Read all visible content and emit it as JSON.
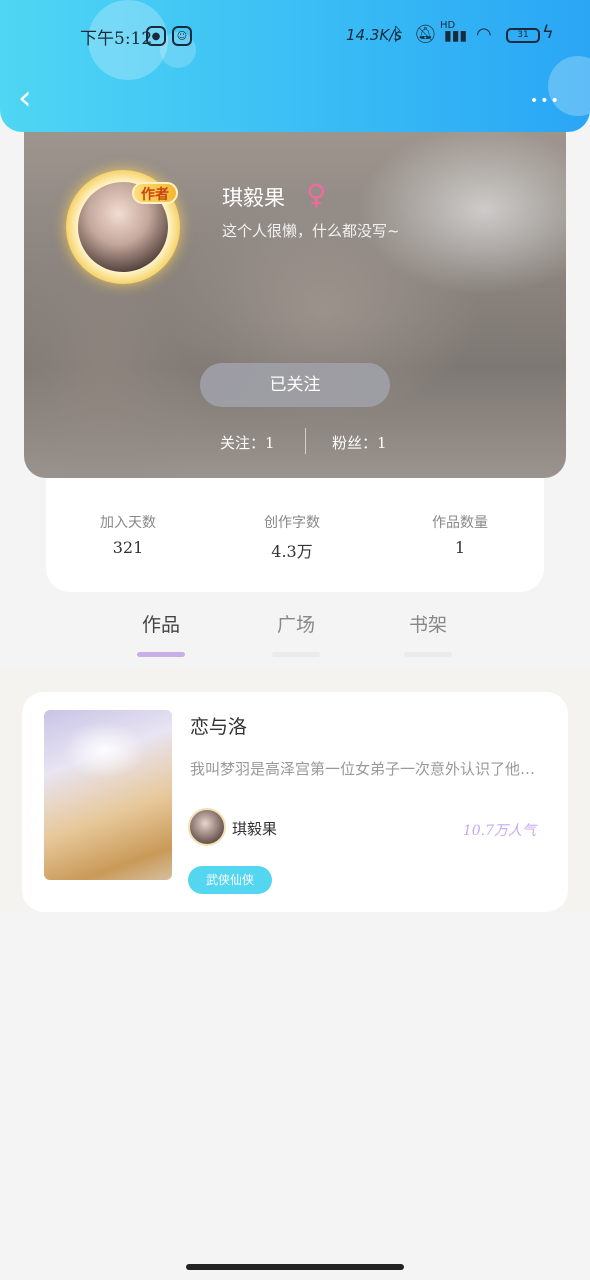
{
  "status_bar": {
    "time": "下午5:12",
    "network_speed": "14.3K/s",
    "network_type": "HD",
    "battery_level": "31",
    "icons": [
      "app-notify-icon",
      "app-notify-icon-2",
      "bluetooth-icon",
      "mute-icon",
      "signal-icon",
      "wifi-icon",
      "battery-icon",
      "charging-icon"
    ]
  },
  "nav": {
    "back_icon": "chevron-left-icon",
    "more_icon": "more-dots-icon",
    "back_glyph": "‹",
    "more_glyph": "•••"
  },
  "profile": {
    "nickname": "琪毅果",
    "gender_symbol": "♀",
    "author_badge": "作者",
    "bio": "这个人很懒，什么都没写~",
    "follow_button_label": "已关注",
    "following_label": "关注：1",
    "followers_label": "粉丝：1"
  },
  "stats": [
    {
      "label": "加入天数",
      "value": "321"
    },
    {
      "label": "创作字数",
      "value": "4.3万"
    },
    {
      "label": "作品数量",
      "value": "1"
    }
  ],
  "tabs": [
    {
      "label": "作品",
      "active": true
    },
    {
      "label": "广场",
      "active": false
    },
    {
      "label": "书架",
      "active": false
    }
  ],
  "works": [
    {
      "title": "恋与洛",
      "description": "我叫梦羽是高泽宫第一位女弟子一次意外认识了他…",
      "author": "琪毅果",
      "popularity": "10.7万人气",
      "genre": "武侠仙侠"
    }
  ],
  "colors": {
    "header_gradient_start": "#4fd6f3",
    "header_gradient_end": "#2aa6f5",
    "tab_active_indicator": "#c6b0e6",
    "genre_tag": "#55d6f0",
    "popularity": "#c8a8f0",
    "gender": "#f06aa0"
  }
}
